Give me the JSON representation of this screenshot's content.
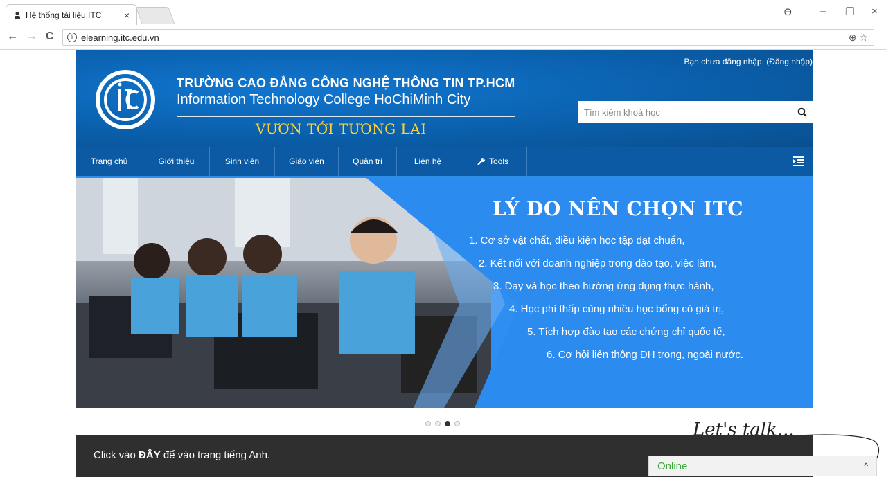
{
  "browser": {
    "tab_title": "Hệ thống tài liệu ITC",
    "tab_close": "×",
    "url": "elearning.itc.edu.vn",
    "back": "←",
    "forward": "→",
    "reload": "C",
    "info": "i",
    "omni_icons": "⊕ ☆",
    "account_icon": "⊖",
    "minimize": "–",
    "restore": "❐",
    "close": "×"
  },
  "header": {
    "login_text": "Bạn chưa đăng nhập. (Đăng nhập)",
    "title": "TRƯỜNG CAO ĐẲNG CÔNG NGHỆ THÔNG TIN TP.HCM",
    "subtitle": "Information Technology College HoChiMinh City",
    "motto": "VƯƠN TỚI TƯƠNG LAI",
    "search_placeholder": "Tìm kiếm khoá học",
    "logo_text": "ITC"
  },
  "nav": {
    "items": [
      {
        "label": "Trang chủ"
      },
      {
        "label": "Giới thiệu"
      },
      {
        "label": "Sinh viên"
      },
      {
        "label": "Giáo viên"
      },
      {
        "label": "Quản trị"
      },
      {
        "label": "Liên hệ"
      },
      {
        "label": "Tools",
        "icon": "wrench-icon"
      }
    ]
  },
  "banner": {
    "title": "LÝ DO NÊN CHỌN ITC",
    "reasons": [
      "1. Cơ sở vật chất, điều kiện học tập đạt chuẩn,",
      "2. Kết nối với doanh nghiệp trong đào tạo, việc làm,",
      "3. Dạy và học theo hướng ứng dụng thực hành,",
      "4. Học phí thấp cùng nhiều học bổng có giá trị,",
      "5. Tích hợp đào tạo các chứng chỉ quốc tế,",
      "6. Cơ hội liên thông ĐH trong, ngoài nước."
    ],
    "active_slide": 3,
    "slide_count": 4
  },
  "footer": {
    "prefix": "Click vào ",
    "link": "ĐÂY",
    "suffix": " để vào trang tiếng Anh."
  },
  "chat": {
    "lets_talk": "Let's talk...",
    "status": "Online",
    "caret": "^"
  },
  "colors": {
    "header_blue": "#0a61b4",
    "nav_blue": "#0b5aa3",
    "banner_blue": "#2b8bef",
    "motto_yellow": "#ffd23a",
    "online_green": "#3aa53a"
  }
}
